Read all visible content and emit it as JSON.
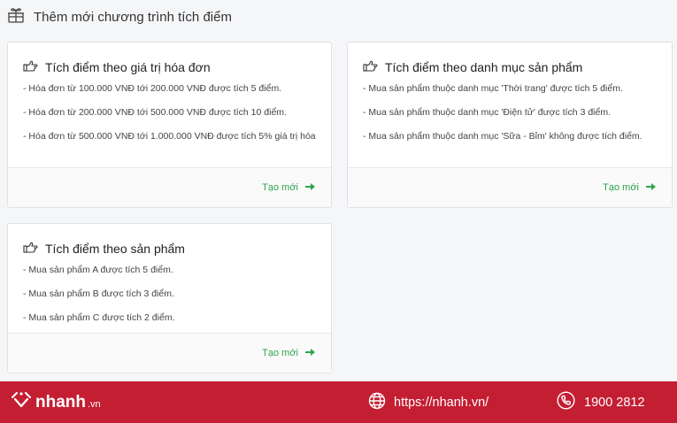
{
  "header": {
    "title": "Thêm mới chương trình tích điểm",
    "icon": "gift-icon"
  },
  "cards": [
    {
      "title": "Tích điểm theo giá trị hóa đơn",
      "icon": "hand-pointing-icon",
      "lines": [
        "- Hóa đơn từ 100.000 VNĐ tới 200.000 VNĐ được tích 5 điểm.",
        "- Hóa đơn từ 200.000 VNĐ tới 500.000 VNĐ được tích 10 điểm.",
        "- Hóa đơn từ 500.000 VNĐ tới 1.000.000 VNĐ được tích 5% giá trị hóa"
      ],
      "action": "Tạo mới"
    },
    {
      "title": "Tích điểm theo danh mục sản phẩm",
      "icon": "hand-pointing-icon",
      "lines": [
        "- Mua sản phẩm thuộc danh mục 'Thời trang' được tích 5 điểm.",
        "- Mua sản phẩm thuộc danh mục 'Điện tử' được tích 3 điểm.",
        "- Mua sản phẩm thuộc danh mục 'Sữa - Bỉm' không được tích điểm."
      ],
      "action": "Tạo mới"
    },
    {
      "title": "Tích điểm theo sản phẩm",
      "icon": "hand-pointing-icon",
      "lines": [
        "- Mua sản phẩm A được tích 5 điểm.",
        "- Mua sản phẩm B được tích 3 điểm.",
        "- Mua sản phẩm C được tích 2 điểm."
      ],
      "action": "Tạo mới"
    }
  ],
  "footer": {
    "brand": "nhanh",
    "brand_tld": ".vn",
    "website": "https://nhanh.vn/",
    "phone": "1900 2812",
    "background_color": "#c41e33",
    "accent_color": "#2da44e"
  }
}
